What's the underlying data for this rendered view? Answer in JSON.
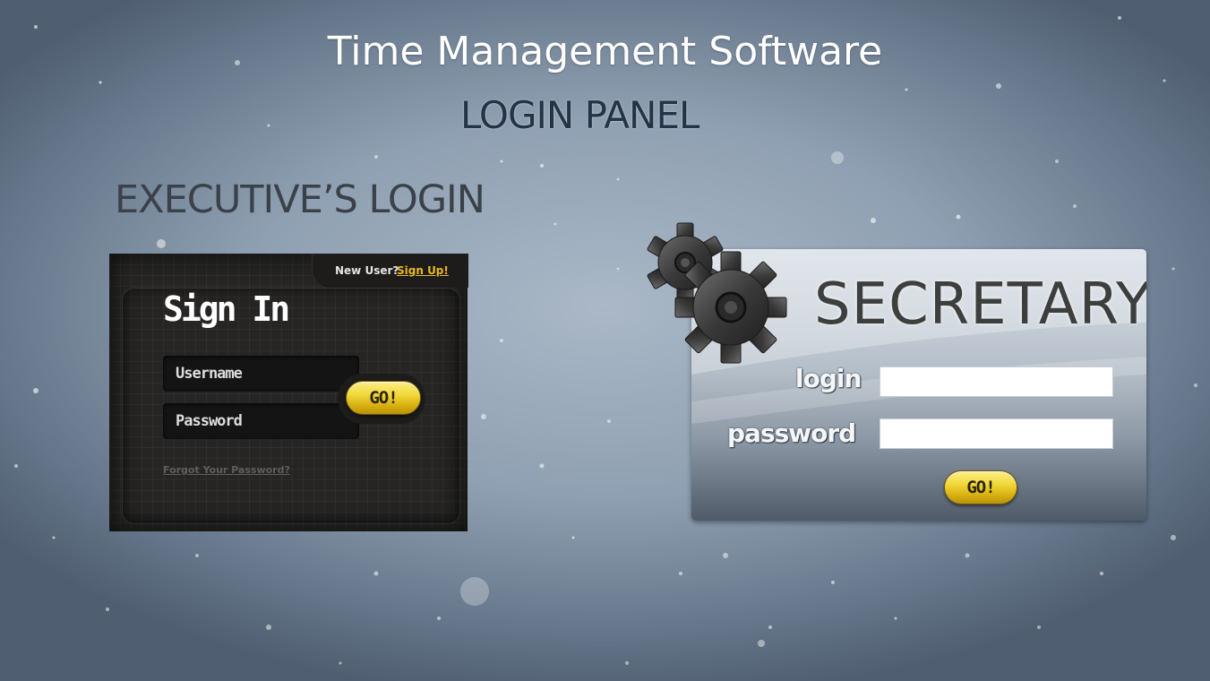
{
  "header": {
    "app_title": "Time Management Software",
    "panel_title": "LOGIN PANEL"
  },
  "executive": {
    "heading": "EXECUTIVE’S LOGIN",
    "new_user_text": "New User?",
    "sign_up_link": "Sign Up!",
    "sign_in_title": "Sign In",
    "username_placeholder": "Username",
    "password_placeholder": "Password",
    "go_label": "GO!",
    "forgot_password_link": "Forgot Your  Password?"
  },
  "secretary": {
    "title": "SECRETARY",
    "login_label": "login",
    "password_label": "password",
    "login_value": "",
    "password_value": "",
    "go_label": "GO!"
  },
  "icons": {
    "gears": "gears-icon"
  },
  "colors": {
    "accent_yellow": "#f2d83a",
    "signup_link": "#e8b825",
    "exec_card_bg": "#262524"
  }
}
